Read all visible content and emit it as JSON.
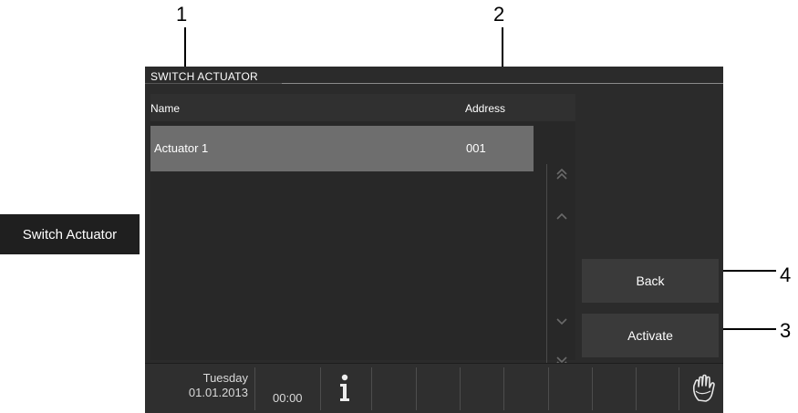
{
  "callouts": {
    "c1": "1",
    "c2": "2",
    "c3": "3",
    "c4": "4"
  },
  "side_label": "Switch Actuator",
  "window": {
    "title": "SWITCH ACTUATOR"
  },
  "table": {
    "headers": {
      "name": "Name",
      "address": "Address"
    },
    "rows": [
      {
        "name": "Actuator 1",
        "address": "001"
      }
    ]
  },
  "scroll": {
    "icons": [
      "double-chevron-up-icon",
      "chevron-up-icon",
      "chevron-down-icon",
      "double-chevron-down-icon"
    ]
  },
  "buttons": {
    "back": "Back",
    "activate": "Activate"
  },
  "status_bar": {
    "day": "Tuesday",
    "date": "01.01.2013",
    "time": "00:00",
    "icons": [
      "info-icon",
      "hand-icon"
    ]
  },
  "colors": {
    "screen_bg": "#2b2b2b",
    "selected_row": "#6e6e6e",
    "button_bg": "#3a3a3a"
  }
}
